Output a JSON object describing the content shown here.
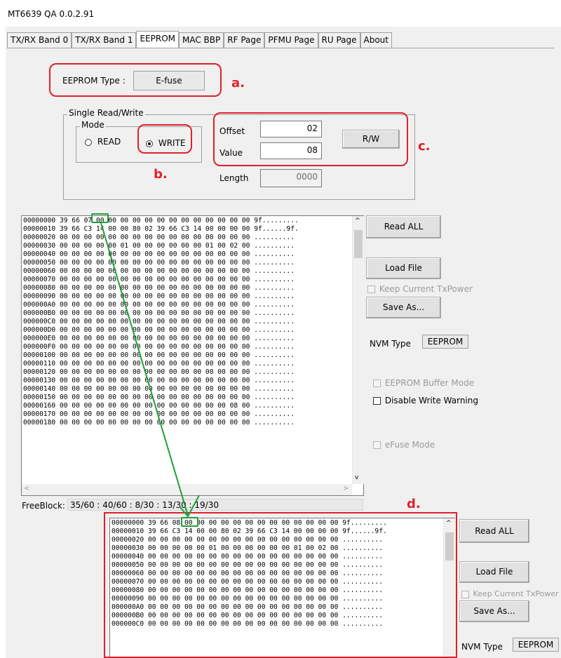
{
  "window": {
    "title": "MT6639 QA 0.0.2.91"
  },
  "tabs": [
    {
      "label": "TX/RX Band 0",
      "active": false
    },
    {
      "label": "TX/RX Band 1",
      "active": false
    },
    {
      "label": "EEPROM",
      "active": true
    },
    {
      "label": "MAC BBP",
      "active": false
    },
    {
      "label": "RF Page",
      "active": false
    },
    {
      "label": "PFMU Page",
      "active": false
    },
    {
      "label": "RU Page",
      "active": false
    },
    {
      "label": "About",
      "active": false
    }
  ],
  "eeprom_type": {
    "label": "EEPROM Type :",
    "value": "E-fuse"
  },
  "single_rw": {
    "group_label": "Single Read/Write",
    "mode_label": "Mode",
    "read_label": "READ",
    "write_label": "WRITE",
    "selected": "WRITE",
    "offset_label": "Offset",
    "offset_value": "02",
    "value_label": "Value",
    "value_value": "08",
    "length_label": "Length",
    "length_value": "0000",
    "rw_button": "R/W"
  },
  "annotations": {
    "a": "a.",
    "b": "b.",
    "c": "c.",
    "d": "d."
  },
  "hex_before": [
    "00000000 39 66 07 00 00 00 00 00 00 00 00 00 00 00 00 00 9f.........",
    "00000010 39 66 C3 14 00 00 80 02 39 66 C3 14 00 00 00 00 9f......9f.",
    "00000020 00 00 00 00 00 00 00 00 00 00 00 00 00 00 00 00 ..........",
    "00000030 00 00 00 00 00 01 00 00 00 00 00 00 01 00 02 00 ..........",
    "00000040 00 00 00 00 00 00 00 00 00 00 00 00 00 00 00 00 ..........",
    "00000050 00 00 00 00 00 00 00 00 00 00 00 00 00 00 00 00 ..........",
    "00000060 00 00 00 00 00 00 00 00 00 00 00 00 00 00 00 00 ..........",
    "00000070 00 00 00 00 00 00 00 00 00 00 00 00 00 00 00 00 ..........",
    "00000080 00 00 00 00 00 00 00 00 00 00 00 00 00 00 00 00 ..........",
    "00000090 00 00 00 00 00 00 00 00 00 00 00 00 00 00 00 00 ..........",
    "000000A0 00 00 00 00 00 00 00 00 00 00 00 00 00 00 00 00 ..........",
    "000000B0 00 00 00 00 00 00 00 00 00 00 00 00 00 00 00 00 ..........",
    "000000C0 00 00 00 00 00 00 00 00 00 00 00 00 00 00 00 00 ..........",
    "000000D0 00 00 00 00 00 00 00 00 00 00 00 00 00 00 00 00 ..........",
    "000000E0 00 00 00 00 00 00 00 00 00 00 00 00 00 00 00 00 ..........",
    "000000F0 00 00 00 00 00 00 00 00 00 00 00 00 00 00 00 00 ..........",
    "00000100 00 00 00 00 00 00 00 00 00 00 00 00 00 00 00 00 ..........",
    "00000110 00 00 00 00 00 00 00 00 00 00 00 00 00 00 00 00 ..........",
    "00000120 00 00 00 00 00 00 00 00 00 00 00 00 00 00 00 00 ..........",
    "00000130 00 00 00 00 00 00 00 00 00 00 00 00 00 00 00 00 ..........",
    "00000140 00 00 00 00 00 00 00 00 00 00 00 00 00 00 00 00 ..........",
    "00000150 00 00 00 00 00 00 00 00 00 00 00 00 00 00 00 00 ..........",
    "00000160 00 00 00 00 00 00 00 00 00 00 00 00 00 00 08 00 ..........",
    "00000170 00 00 00 00 00 00 00 00 00 00 00 00 00 00 00 00 ..........",
    "00000180 00 00 00 00 00 00 00 00 00 00 00 00 00 00 00 00 .........."
  ],
  "hex_after": [
    "00000000 39 66 08 00 00 00 00 00 00 00 00 00 00 00 00 00 9f.........",
    "00000010 39 66 C3 14 00 00 80 02 39 66 C3 14 00 00 00 00 9f......9f.",
    "00000020 00 00 00 00 00 00 00 00 00 00 00 00 00 00 00 00 ..........",
    "00000030 00 00 00 00 00 01 00 00 00 00 00 00 01 00 02 00 ..........",
    "00000040 00 00 00 00 00 00 00 00 00 00 00 00 00 00 00 00 ..........",
    "00000050 00 00 00 00 00 00 00 00 00 00 00 00 00 00 00 00 ..........",
    "00000060 00 00 00 00 00 00 00 00 00 00 00 00 00 00 00 00 ..........",
    "00000070 00 00 00 00 00 00 00 00 00 00 00 00 00 00 00 00 ..........",
    "00000080 00 00 00 00 00 00 00 00 00 00 00 00 00 00 00 00 ..........",
    "00000090 00 00 00 00 00 00 00 00 00 00 00 00 00 00 00 00 ..........",
    "000000A0 00 00 00 00 00 00 00 00 00 00 00 00 00 00 00 00 ..........",
    "000000B0 00 00 00 00 00 00 00 00 00 00 00 00 00 00 00 00 ..........",
    "000000C0 00 00 00 00 00 00 00 00 00 00 00 00 00 00 00 00 .........."
  ],
  "buttons": {
    "read_all": "Read ALL",
    "load_file": "Load File",
    "save_as": "Save As..."
  },
  "checkboxes": {
    "keep_txpower": "Keep Current TxPower",
    "buffer_mode": "EEPROM Buffer Mode",
    "disable_write_warning": "Disable Write Warning",
    "efuse_mode": "eFuse Mode"
  },
  "nvm": {
    "label": "NVM Type",
    "value": "EEPROM"
  },
  "freeblock": {
    "label": "FreeBlock:",
    "value": "35/60 : 40/60 : 8/30 : 13/30 : 19/30"
  },
  "colors": {
    "annotation_red": "#e0202a",
    "highlight_green": "#1fa03a"
  },
  "icons": {
    "scroll_up": "chevron-up-icon",
    "scroll_down": "chevron-down-icon",
    "scroll_left": "chevron-left-icon",
    "scroll_right": "chevron-right-icon"
  }
}
